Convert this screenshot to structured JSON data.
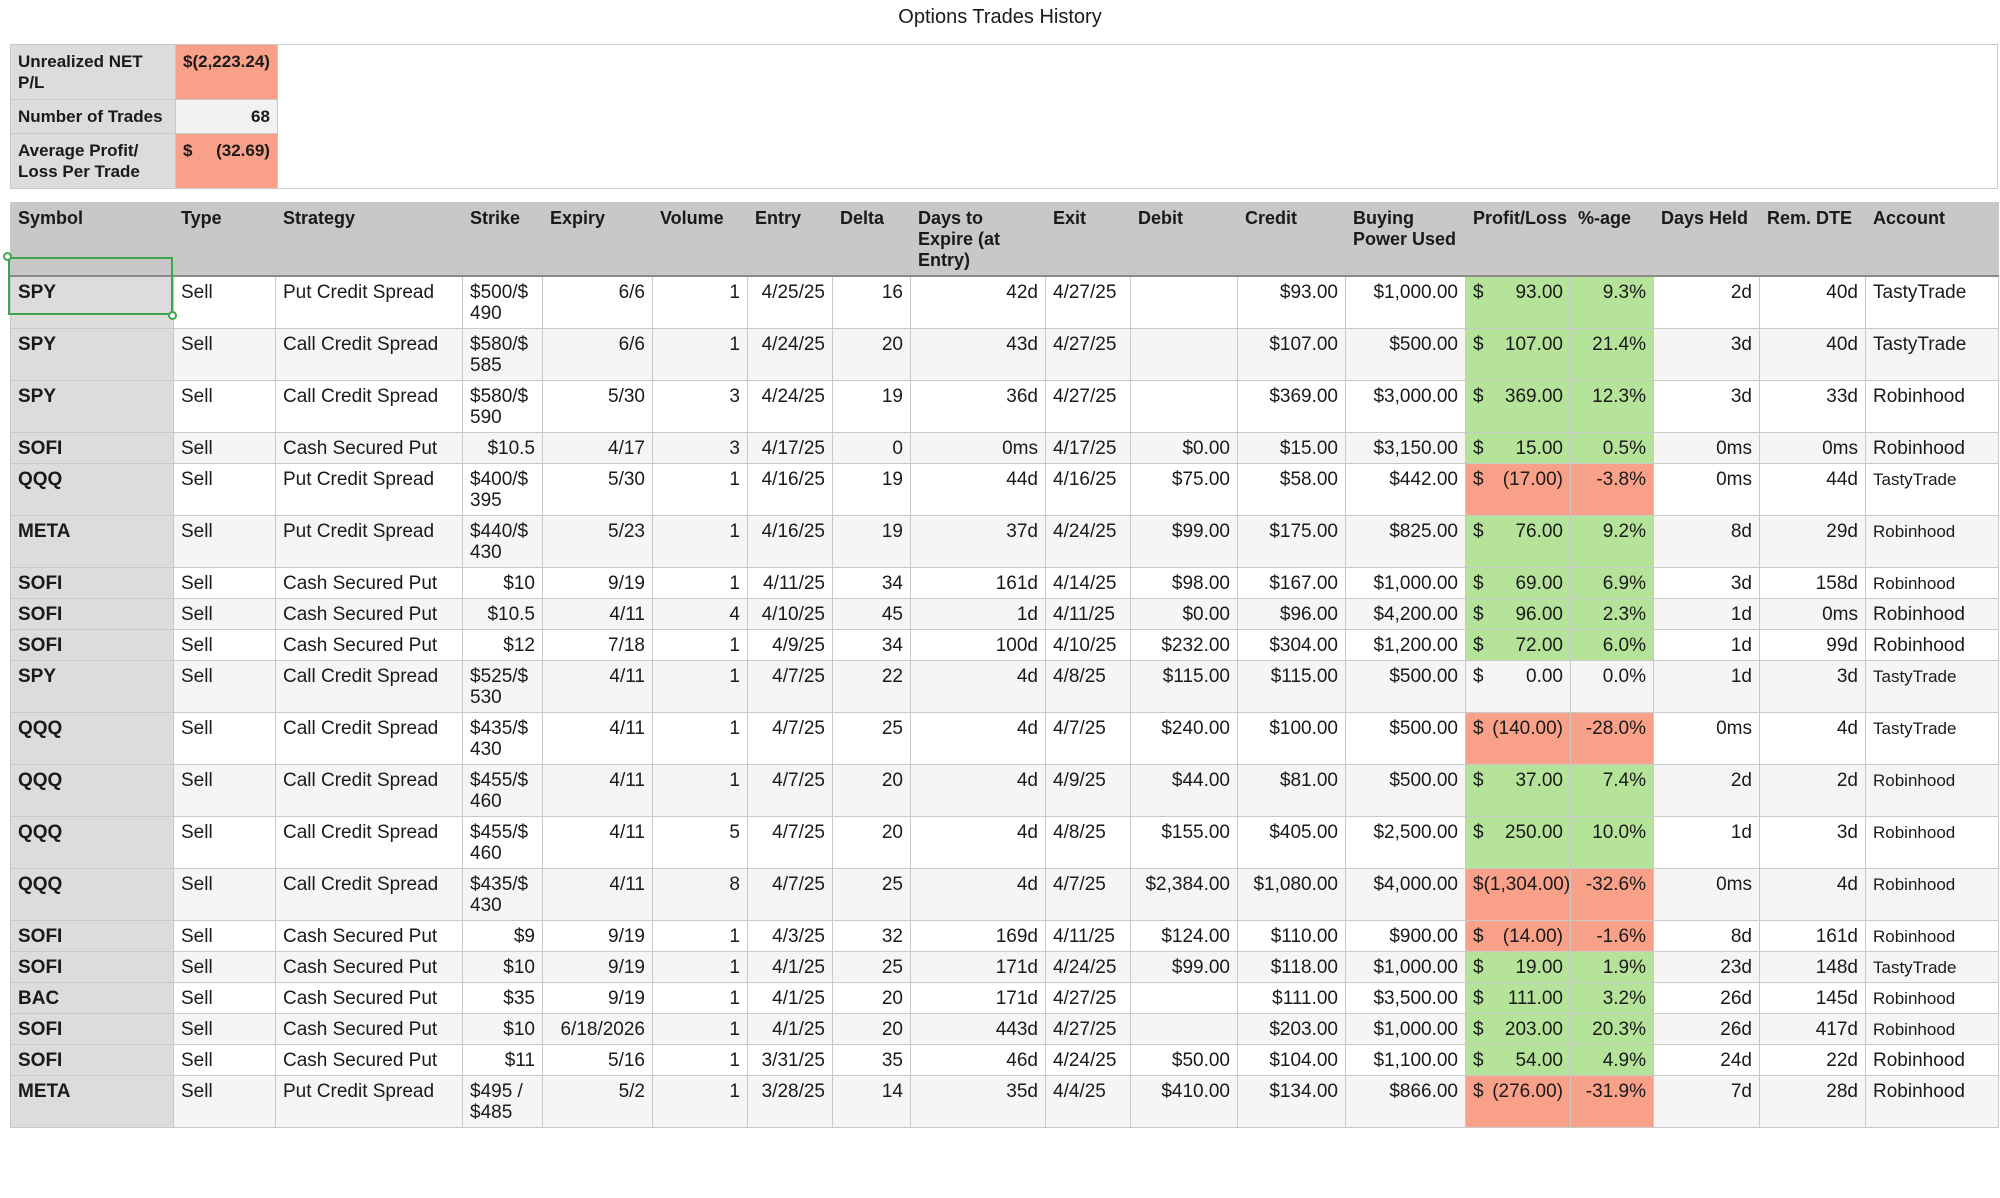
{
  "title": "Options Trades History",
  "summary": {
    "net_label": "Unrealized NET P/L",
    "net_value": "$(2,223.24)",
    "trades_label": "Number of Trades",
    "trades_value": "68",
    "avg_label": "Average Profit/ Loss Per Trade",
    "avg_currency": "$",
    "avg_value": "(32.69)"
  },
  "columns": [
    "Symbol",
    "Type",
    "Strategy",
    "Strike",
    "Expiry",
    "Volume",
    "Entry",
    "Delta",
    "Days to Expire (at Entry)",
    "Exit",
    "Debit",
    "Credit",
    "Buying Power Used",
    "Profit/Loss",
    "%-age",
    "Days Held",
    "Rem. DTE",
    "Account"
  ],
  "rows": [
    {
      "symbol": "SPY",
      "type": "Sell",
      "strategy": "Put Credit Spread",
      "strike": "$500/$ 490",
      "expiry": "6/6",
      "volume": "1",
      "entry": "4/25/25",
      "delta": "16",
      "dte": "42d",
      "exit": "4/27/25",
      "debit": "",
      "credit": "$93.00",
      "bp": "$1,000.00",
      "pl_cur": "$",
      "pl": "93.00",
      "pct": "9.3%",
      "held": "2d",
      "rem": "40d",
      "account": "TastyTrade",
      "status": "pos"
    },
    {
      "symbol": "SPY",
      "type": "Sell",
      "strategy": "Call Credit Spread",
      "strike": "$580/$ 585",
      "expiry": "6/6",
      "volume": "1",
      "entry": "4/24/25",
      "delta": "20",
      "dte": "43d",
      "exit": "4/27/25",
      "debit": "",
      "credit": "$107.00",
      "bp": "$500.00",
      "pl_cur": "$",
      "pl": "107.00",
      "pct": "21.4%",
      "held": "3d",
      "rem": "40d",
      "account": "TastyTrade",
      "status": "pos"
    },
    {
      "symbol": "SPY",
      "type": "Sell",
      "strategy": "Call Credit Spread",
      "strike": "$580/$ 590",
      "expiry": "5/30",
      "volume": "3",
      "entry": "4/24/25",
      "delta": "19",
      "dte": "36d",
      "exit": "4/27/25",
      "debit": "",
      "credit": "$369.00",
      "bp": "$3,000.00",
      "pl_cur": "$",
      "pl": "369.00",
      "pct": "12.3%",
      "held": "3d",
      "rem": "33d",
      "account": "Robinhood",
      "status": "pos"
    },
    {
      "symbol": "SOFI",
      "type": "Sell",
      "strategy": "Cash Secured Put",
      "strike": "$10.5",
      "expiry": "4/17",
      "volume": "3",
      "entry": "4/17/25",
      "delta": "0",
      "dte": "0ms",
      "exit": "4/17/25",
      "debit": "$0.00",
      "credit": "$15.00",
      "bp": "$3,150.00",
      "pl_cur": "$",
      "pl": "15.00",
      "pct": "0.5%",
      "held": "0ms",
      "rem": "0ms",
      "account": "Robinhood",
      "status": "pos"
    },
    {
      "symbol": "QQQ",
      "type": "Sell",
      "strategy": "Put Credit Spread",
      "strike": "$400/$ 395",
      "expiry": "5/30",
      "volume": "1",
      "entry": "4/16/25",
      "delta": "19",
      "dte": "44d",
      "exit": "4/16/25",
      "debit": "$75.00",
      "credit": "$58.00",
      "bp": "$442.00",
      "pl_cur": "$",
      "pl": "(17.00)",
      "pct": "-3.8%",
      "held": "0ms",
      "rem": "44d",
      "account": "TastyTrade",
      "status": "neg"
    },
    {
      "symbol": "META",
      "type": "Sell",
      "strategy": "Put Credit Spread",
      "strike": "$440/$ 430",
      "expiry": "5/23",
      "volume": "1",
      "entry": "4/16/25",
      "delta": "19",
      "dte": "37d",
      "exit": "4/24/25",
      "debit": "$99.00",
      "credit": "$175.00",
      "bp": "$825.00",
      "pl_cur": "$",
      "pl": "76.00",
      "pct": "9.2%",
      "held": "8d",
      "rem": "29d",
      "account": "Robinhood",
      "status": "pos"
    },
    {
      "symbol": "SOFI",
      "type": "Sell",
      "strategy": "Cash Secured Put",
      "strike": "$10",
      "expiry": "9/19",
      "volume": "1",
      "entry": "4/11/25",
      "delta": "34",
      "dte": "161d",
      "exit": "4/14/25",
      "debit": "$98.00",
      "credit": "$167.00",
      "bp": "$1,000.00",
      "pl_cur": "$",
      "pl": "69.00",
      "pct": "6.9%",
      "held": "3d",
      "rem": "158d",
      "account": "Robinhood",
      "status": "pos"
    },
    {
      "symbol": "SOFI",
      "type": "Sell",
      "strategy": "Cash Secured Put",
      "strike": "$10.5",
      "expiry": "4/11",
      "volume": "4",
      "entry": "4/10/25",
      "delta": "45",
      "dte": "1d",
      "exit": "4/11/25",
      "debit": "$0.00",
      "credit": "$96.00",
      "bp": "$4,200.00",
      "pl_cur": "$",
      "pl": "96.00",
      "pct": "2.3%",
      "held": "1d",
      "rem": "0ms",
      "account": "Robinhood",
      "status": "pos"
    },
    {
      "symbol": "SOFI",
      "type": "Sell",
      "strategy": "Cash Secured Put",
      "strike": "$12",
      "expiry": "7/18",
      "volume": "1",
      "entry": "4/9/25",
      "delta": "34",
      "dte": "100d",
      "exit": "4/10/25",
      "debit": "$232.00",
      "credit": "$304.00",
      "bp": "$1,200.00",
      "pl_cur": "$",
      "pl": "72.00",
      "pct": "6.0%",
      "held": "1d",
      "rem": "99d",
      "account": "Robinhood",
      "status": "pos"
    },
    {
      "symbol": "SPY",
      "type": "Sell",
      "strategy": "Call Credit Spread",
      "strike": "$525/$ 530",
      "expiry": "4/11",
      "volume": "1",
      "entry": "4/7/25",
      "delta": "22",
      "dte": "4d",
      "exit": "4/8/25",
      "debit": "$115.00",
      "credit": "$115.00",
      "bp": "$500.00",
      "pl_cur": "$",
      "pl": "0.00",
      "pct": "0.0%",
      "held": "1d",
      "rem": "3d",
      "account": "TastyTrade",
      "status": "zero"
    },
    {
      "symbol": "QQQ",
      "type": "Sell",
      "strategy": "Call Credit Spread",
      "strike": "$435/$ 430",
      "expiry": "4/11",
      "volume": "1",
      "entry": "4/7/25",
      "delta": "25",
      "dte": "4d",
      "exit": "4/7/25",
      "debit": "$240.00",
      "credit": "$100.00",
      "bp": "$500.00",
      "pl_cur": "$",
      "pl": "(140.00)",
      "pct": "-28.0%",
      "held": "0ms",
      "rem": "4d",
      "account": "TastyTrade",
      "status": "neg"
    },
    {
      "symbol": "QQQ",
      "type": "Sell",
      "strategy": "Call Credit Spread",
      "strike": "$455/$ 460",
      "expiry": "4/11",
      "volume": "1",
      "entry": "4/7/25",
      "delta": "20",
      "dte": "4d",
      "exit": "4/9/25",
      "debit": "$44.00",
      "credit": "$81.00",
      "bp": "$500.00",
      "pl_cur": "$",
      "pl": "37.00",
      "pct": "7.4%",
      "held": "2d",
      "rem": "2d",
      "account": "Robinhood",
      "status": "pos"
    },
    {
      "symbol": "QQQ",
      "type": "Sell",
      "strategy": "Call Credit Spread",
      "strike": "$455/$ 460",
      "expiry": "4/11",
      "volume": "5",
      "entry": "4/7/25",
      "delta": "20",
      "dte": "4d",
      "exit": "4/8/25",
      "debit": "$155.00",
      "credit": "$405.00",
      "bp": "$2,500.00",
      "pl_cur": "$",
      "pl": "250.00",
      "pct": "10.0%",
      "held": "1d",
      "rem": "3d",
      "account": "Robinhood",
      "status": "pos"
    },
    {
      "symbol": "QQQ",
      "type": "Sell",
      "strategy": "Call Credit Spread",
      "strike": "$435/$ 430",
      "expiry": "4/11",
      "volume": "8",
      "entry": "4/7/25",
      "delta": "25",
      "dte": "4d",
      "exit": "4/7/25",
      "debit": "$2,384.00",
      "credit": "$1,080.00",
      "bp": "$4,000.00",
      "pl_cur": "",
      "pl": "$(1,304.00)",
      "pct": "-32.6%",
      "held": "0ms",
      "rem": "4d",
      "account": "Robinhood",
      "status": "neg"
    },
    {
      "symbol": "SOFI",
      "type": "Sell",
      "strategy": "Cash Secured Put",
      "strike": "$9",
      "expiry": "9/19",
      "volume": "1",
      "entry": "4/3/25",
      "delta": "32",
      "dte": "169d",
      "exit": "4/11/25",
      "debit": "$124.00",
      "credit": "$110.00",
      "bp": "$900.00",
      "pl_cur": "$",
      "pl": "(14.00)",
      "pct": "-1.6%",
      "held": "8d",
      "rem": "161d",
      "account": "Robinhood",
      "status": "neg"
    },
    {
      "symbol": "SOFI",
      "type": "Sell",
      "strategy": "Cash Secured Put",
      "strike": "$10",
      "expiry": "9/19",
      "volume": "1",
      "entry": "4/1/25",
      "delta": "25",
      "dte": "171d",
      "exit": "4/24/25",
      "debit": "$99.00",
      "credit": "$118.00",
      "bp": "$1,000.00",
      "pl_cur": "$",
      "pl": "19.00",
      "pct": "1.9%",
      "held": "23d",
      "rem": "148d",
      "account": "TastyTrade",
      "status": "pos"
    },
    {
      "symbol": "BAC",
      "type": "Sell",
      "strategy": "Cash Secured Put",
      "strike": "$35",
      "expiry": "9/19",
      "volume": "1",
      "entry": "4/1/25",
      "delta": "20",
      "dte": "171d",
      "exit": "4/27/25",
      "debit": "",
      "credit": "$111.00",
      "bp": "$3,500.00",
      "pl_cur": "$",
      "pl": "111.00",
      "pct": "3.2%",
      "held": "26d",
      "rem": "145d",
      "account": "Robinhood",
      "status": "pos"
    },
    {
      "symbol": "SOFI",
      "type": "Sell",
      "strategy": "Cash Secured Put",
      "strike": "$10",
      "expiry": "6/18/2026",
      "volume": "1",
      "entry": "4/1/25",
      "delta": "20",
      "dte": "443d",
      "exit": "4/27/25",
      "debit": "",
      "credit": "$203.00",
      "bp": "$1,000.00",
      "pl_cur": "$",
      "pl": "203.00",
      "pct": "20.3%",
      "held": "26d",
      "rem": "417d",
      "account": "Robinhood",
      "status": "pos"
    },
    {
      "symbol": "SOFI",
      "type": "Sell",
      "strategy": "Cash Secured Put",
      "strike": "$11",
      "expiry": "5/16",
      "volume": "1",
      "entry": "3/31/25",
      "delta": "35",
      "dte": "46d",
      "exit": "4/24/25",
      "debit": "$50.00",
      "credit": "$104.00",
      "bp": "$1,100.00",
      "pl_cur": "$",
      "pl": "54.00",
      "pct": "4.9%",
      "held": "24d",
      "rem": "22d",
      "account": "Robinhood",
      "status": "pos"
    },
    {
      "symbol": "META",
      "type": "Sell",
      "strategy": "Put Credit Spread",
      "strike": "$495 / $485",
      "expiry": "5/2",
      "volume": "1",
      "entry": "3/28/25",
      "delta": "14",
      "dte": "35d",
      "exit": "4/4/25",
      "debit": "$410.00",
      "credit": "$134.00",
      "bp": "$866.00",
      "pl_cur": "$",
      "pl": "(276.00)",
      "pct": "-31.9%",
      "held": "7d",
      "rem": "28d",
      "account": "Robinhood",
      "status": "neg"
    }
  ],
  "colors": {
    "positive": "#b6e39a",
    "negative": "#f9a089",
    "header": "#c8c8c8",
    "selection": "#3aa84a"
  }
}
